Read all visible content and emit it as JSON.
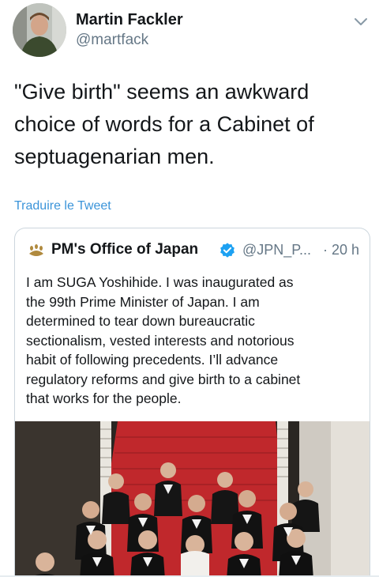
{
  "author": {
    "name": "Martin Fackler",
    "handle": "@martfack"
  },
  "tweet": {
    "text_lines": [
      "\"Give birth\" seems an awkward",
      "choice of words for a Cabinet of",
      "septuagenarian men."
    ],
    "translate_label": "Traduire le Tweet"
  },
  "quoted_tweet": {
    "name": "PM's Office of Japan",
    "handle": "@JPN_P...",
    "time": "· 20 h",
    "text_lines": [
      "I am SUGA Yoshihide. I was inaugurated as",
      "the 99th Prime Minister of Japan. I am",
      "determined to tear down bureaucratic",
      "sectionalism, vested interests and notorious",
      "habit of following precedents. I’ll advance",
      "regulatory reforms and give birth to a cabinet",
      "that works for the people."
    ]
  },
  "icons": {
    "more": "chevron-down-icon",
    "logo": "paulownia-crest-icon",
    "verified": "verified-badge-icon"
  },
  "colors": {
    "link": "#3b94d9",
    "verified": "#1da1f2",
    "secondary_text": "#657786",
    "carpet": "#c0282c"
  }
}
